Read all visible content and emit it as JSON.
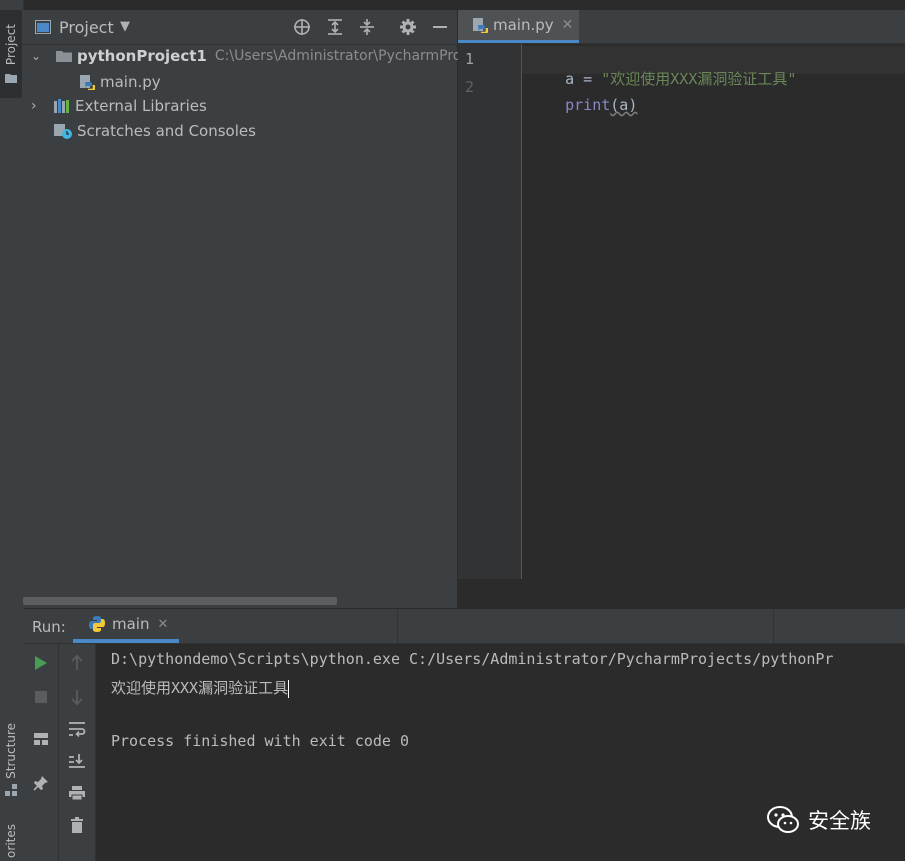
{
  "left_strip": {
    "project_tab": "Project",
    "structure_tab": "Structure",
    "favorites_tab": "orites"
  },
  "project_panel": {
    "title": "Project",
    "tree": [
      {
        "name": "pythonProject1",
        "path": "C:\\Users\\Administrator\\PycharmPro"
      },
      {
        "name": "main.py"
      },
      {
        "name": "External Libraries"
      },
      {
        "name": "Scratches and Consoles"
      }
    ]
  },
  "editor": {
    "tab_label": "main.py",
    "line_numbers": [
      "1",
      "2"
    ],
    "lines": [
      {
        "var": "a",
        "op": " = ",
        "string": "\"欢迎使用XXX漏洞验证工具\""
      },
      {
        "func": "print",
        "args": "(a)"
      }
    ]
  },
  "run": {
    "label": "Run:",
    "tab_label": "main",
    "output": [
      "D:\\pythondemo\\Scripts\\python.exe C:/Users/Administrator/PycharmProjects/pythonPr",
      "欢迎使用XXX漏洞验证工具",
      "Process finished with exit code 0"
    ]
  },
  "watermark": {
    "text": "安全族"
  },
  "colors": {
    "string": "#6a8759",
    "keyword": "#8888c6",
    "run_green": "#499c54",
    "tab_underline": "#4a88c7"
  }
}
